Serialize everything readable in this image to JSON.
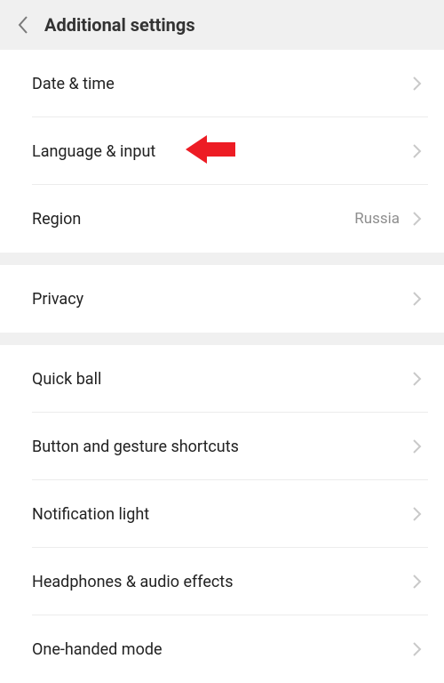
{
  "header": {
    "title": "Additional settings"
  },
  "sections": [
    {
      "items": [
        {
          "label": "Date & time",
          "value": null
        },
        {
          "label": "Language & input",
          "value": null
        },
        {
          "label": "Region",
          "value": "Russia"
        }
      ]
    },
    {
      "items": [
        {
          "label": "Privacy",
          "value": null
        }
      ]
    },
    {
      "items": [
        {
          "label": "Quick ball",
          "value": null
        },
        {
          "label": "Button and gesture shortcuts",
          "value": null
        },
        {
          "label": "Notification light",
          "value": null
        },
        {
          "label": "Headphones & audio effects",
          "value": null
        },
        {
          "label": "One-handed mode",
          "value": null
        }
      ]
    }
  ],
  "annotation": {
    "highlight_item": "language-input"
  }
}
